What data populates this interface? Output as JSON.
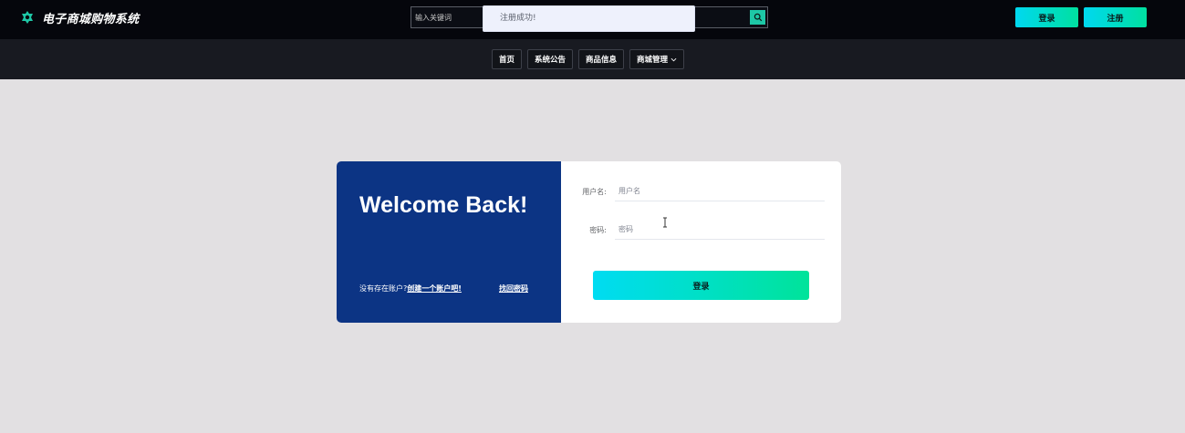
{
  "header": {
    "brand": "电子商城购物系统",
    "search_placeholder": "输入关键词",
    "login_label": "登录",
    "register_label": "注册"
  },
  "toast": {
    "message": "注册成功!"
  },
  "nav": {
    "items": [
      "首页",
      "系统公告",
      "商品信息",
      "商城管理"
    ]
  },
  "login_card": {
    "welcome": "Welcome Back!",
    "no_account_text": "没有存在账户?",
    "create_link": "创建一个账户吧!",
    "forgot_link": "找回密码",
    "username_label": "用户名:",
    "username_placeholder": "用户名",
    "password_label": "密码:",
    "password_placeholder": "密码",
    "submit_label": "登录"
  },
  "colors": {
    "topbar": "#05060c",
    "navbar": "#181a21",
    "accent_start": "#00d8f0",
    "accent_end": "#00e0a0",
    "card_left": "#0c3484",
    "page_bg": "#e2e0e2"
  }
}
